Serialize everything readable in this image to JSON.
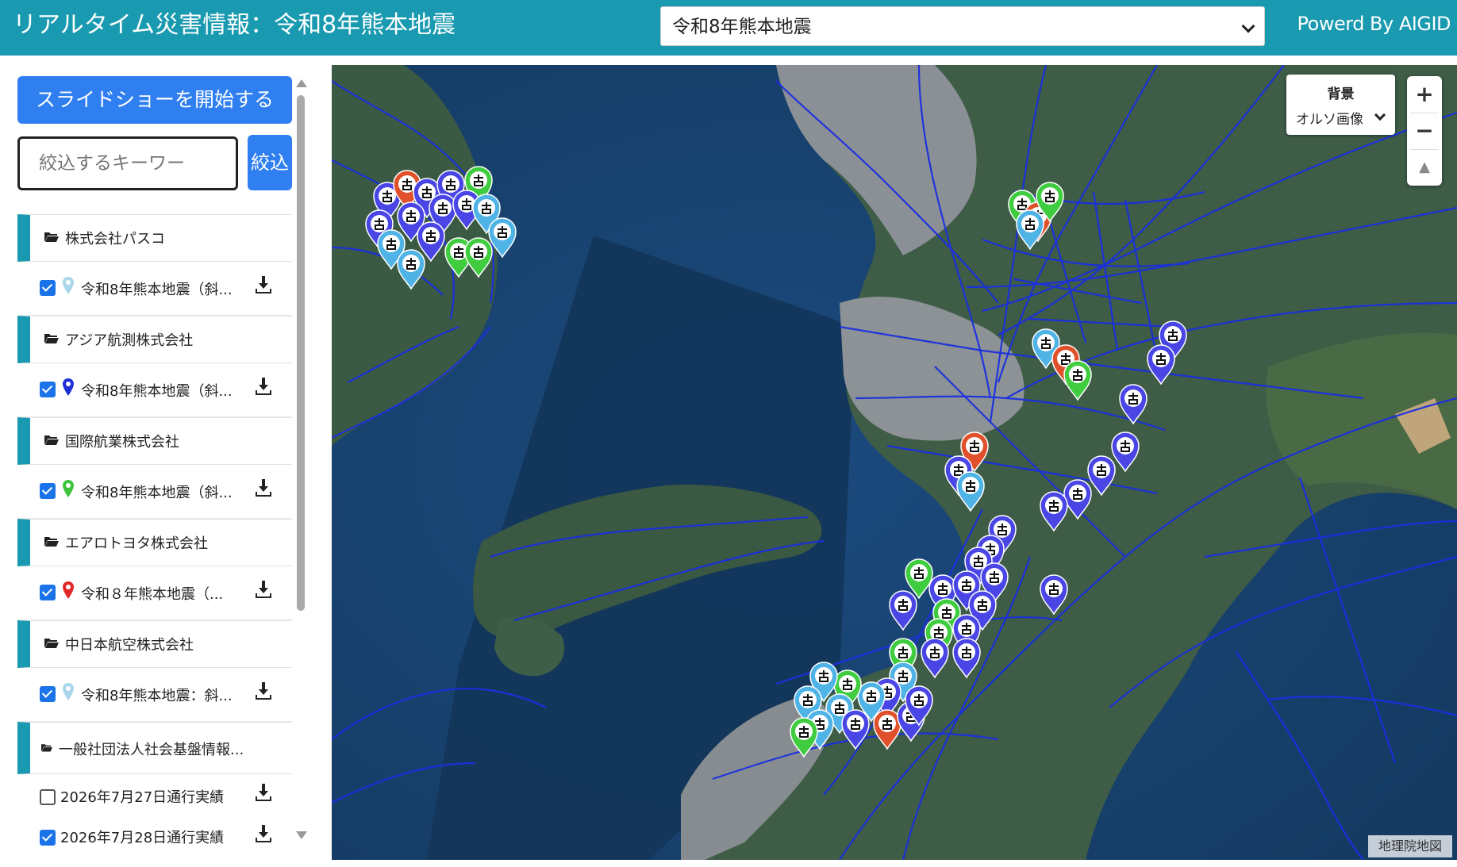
{
  "header": {
    "title": "リアルタイム災害情報：令和8年熊本地震",
    "event_select_value": "令和8年熊本地震",
    "powered_by": "Powerd By AIGID"
  },
  "sidebar": {
    "slideshow_label": "スライドショーを開始する",
    "filter_placeholder": "絞込するキーワー",
    "filter_button": "絞込",
    "groups": [
      {
        "label": "株式会社パスコ",
        "layer": {
          "label": "令和8年熊本地震（斜...",
          "checked": true,
          "pin_color": "#a9d6ea"
        }
      },
      {
        "label": "アジア航測株式会社",
        "layer": {
          "label": "令和8年熊本地震（斜...",
          "checked": true,
          "pin_color": "#1e2fd6"
        }
      },
      {
        "label": "国際航業株式会社",
        "layer": {
          "label": "令和8年熊本地震（斜...",
          "checked": true,
          "pin_color": "#3cc43c"
        }
      },
      {
        "label": "エアロトヨタ株式会社",
        "layer": {
          "label": "令和８年熊本地震（...",
          "checked": true,
          "pin_color": "#e02828"
        }
      },
      {
        "label": "中日本航空株式会社",
        "layer": {
          "label": "令和8年熊本地震：斜...",
          "checked": true,
          "pin_color": "#a9d6ea"
        }
      }
    ],
    "last_group": {
      "label": "一般社団法人社会基盤情報...",
      "layers": [
        {
          "label": "2026年7月27日通行実績",
          "checked": false
        },
        {
          "label": "2026年7月28日通行実績",
          "checked": true
        }
      ]
    }
  },
  "map": {
    "background_control": {
      "title": "背景",
      "value": "オルソ画像"
    },
    "zoom_in": "+",
    "zoom_out": "−",
    "compass": "▲",
    "attribution": "地理院地図",
    "marker_colors": {
      "blue": "#4a46e6",
      "cyan": "#4fb3e6",
      "green": "#3fcc3f",
      "red": "#e0502a"
    }
  }
}
